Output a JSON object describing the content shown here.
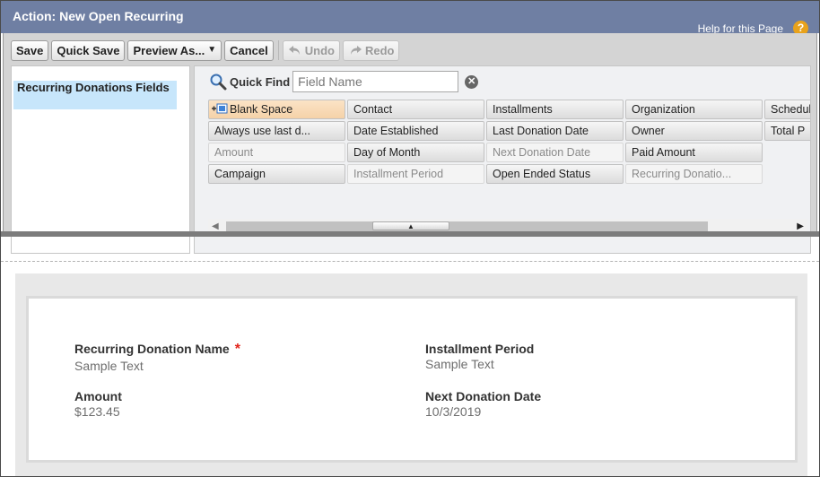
{
  "window": {
    "title": "Action: New Open Recurring",
    "help_link": "Help for this Page",
    "help_icon": "?"
  },
  "toolbar": {
    "save": "Save",
    "quick_save": "Quick Save",
    "preview_as": "Preview As...",
    "cancel": "Cancel",
    "undo": "Undo",
    "redo": "Redo"
  },
  "palette": {
    "category": "Recurring Donations Fields",
    "quick_find_label": "Quick Find",
    "quick_find_placeholder": "Field Name",
    "rows": [
      [
        "Blank Space",
        "Contact",
        "Installments",
        "Organization",
        "Schedule"
      ],
      [
        "Always use last d...",
        "Date Established",
        "Last Donation Date",
        "Owner",
        "Total P"
      ],
      [
        "Amount",
        "Day of Month",
        "Next Donation Date",
        "Paid Amount",
        ""
      ],
      [
        "Campaign",
        "Installment Period",
        "Open Ended Status",
        "Recurring Donatio...",
        ""
      ]
    ],
    "used_fields": [
      "Amount",
      "Installment Period",
      "Next Donation Date",
      "Recurring Donatio..."
    ]
  },
  "layout": {
    "fields": {
      "name_label": "Recurring Donation Name",
      "name_value": "Sample Text",
      "required_marker": "*",
      "installment_label": "Installment Period",
      "installment_value": "Sample Text",
      "amount_label": "Amount",
      "amount_value": "$123.45",
      "next_date_label": "Next Donation Date",
      "next_date_value": "10/3/2019"
    }
  },
  "colors": {
    "title_bar": "#6f7fa3",
    "selected_category": "#c7e6fb",
    "required": "#e2231a",
    "help_icon": "#e8a21b"
  }
}
